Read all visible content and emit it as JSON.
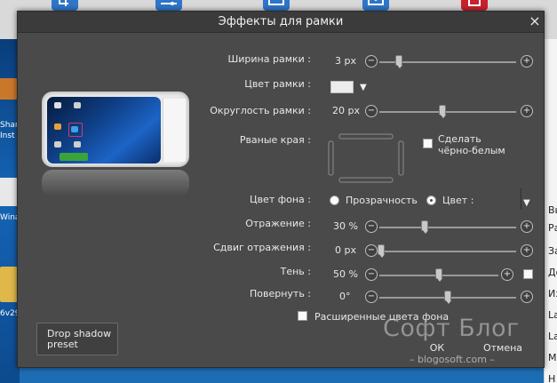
{
  "dialog": {
    "title": "Эффекты для рамки",
    "close_symbol": "×"
  },
  "controls": {
    "frame_width": {
      "label": "Ширина рамки :",
      "value": "3 px",
      "level": 0.1
    },
    "frame_color": {
      "label": "Цвет рамки :",
      "swatch_color": "#ececec",
      "dropdown_symbol": "▼"
    },
    "frame_rounding": {
      "label": "Округлость рамки :",
      "value": "20 px",
      "level": 0.46
    },
    "torn_edges": {
      "label": "Рваные края :"
    },
    "black_white": {
      "label_line1": "Сделать",
      "label_line2": "чёрно-белым",
      "checked": false
    },
    "background_color": {
      "label": "Цвет фона :",
      "option_transparent": "Прозрачность",
      "option_color": "Цвет :",
      "selected": "Цвет :",
      "dropdown_symbol": "▼"
    },
    "reflection": {
      "label": "Отражение :",
      "value": "30 %",
      "level": 0.31
    },
    "reflection_offset": {
      "label": "Сдвиг отражения :",
      "value": "0 px",
      "level": 0.0
    },
    "shadow": {
      "label": "Тень :",
      "value": "50 %",
      "level": 0.5
    },
    "rotate": {
      "label": "Повернуть :",
      "value": "0°",
      "level": 0.5
    },
    "extended_colors": {
      "label": "Расширенные цвета фона",
      "checked": false
    }
  },
  "buttons": {
    "minus_symbol": "−",
    "plus_symbol": "+",
    "preset": "Drop shadow preset",
    "ok": "ОК",
    "cancel": "Отмена"
  },
  "background_app": {
    "desktop_icons": [
      "Shar",
      "Inst",
      "Wina",
      "6v29"
    ],
    "right_panel_items": [
      "Выб",
      "Ра",
      "За",
      "До",
      "Из",
      "La",
      "La",
      "М",
      "Н"
    ]
  },
  "watermark": {
    "main": "Софт Блог",
    "sub": "– blogosoft.com –"
  },
  "colors": {
    "dialog_bg": "#4a4a4a",
    "titlebar_bg": "#3b3b3b",
    "text": "#e8e8e8",
    "desktop_blue": "#1d6db4"
  }
}
